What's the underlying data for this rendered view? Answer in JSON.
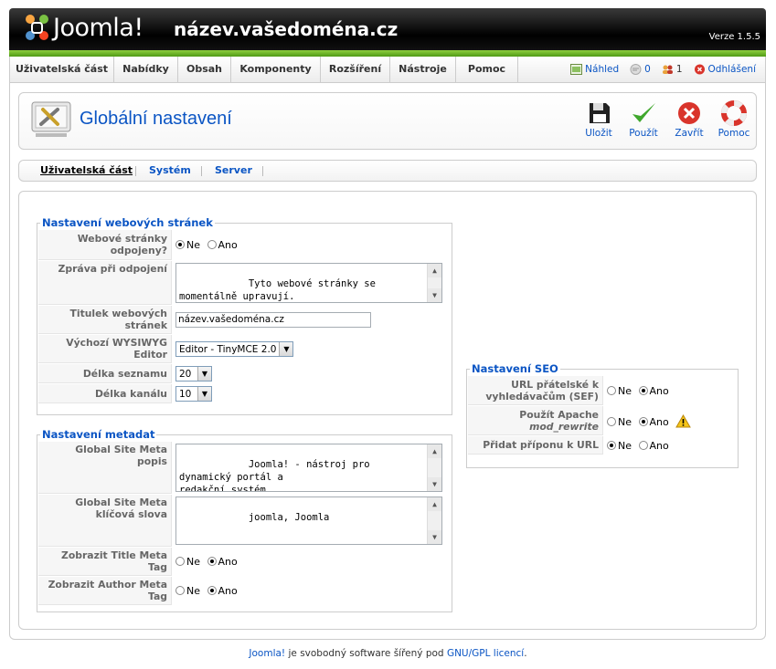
{
  "header": {
    "logo_text": "Joomla!",
    "site_name": "název.vašedoména.cz",
    "version": "Verze 1.5.5"
  },
  "menu": {
    "items": [
      "Uživatelská část",
      "Nabídky",
      "Obsah",
      "Komponenty",
      "Rozšíření",
      "Nástroje",
      "Pomoc"
    ],
    "preview": "Náhled",
    "messages_count": "0",
    "users_count": "1",
    "logout": "Odhlášení"
  },
  "toolbar": {
    "title": "Globální nastavení",
    "save": "Uložit",
    "apply": "Použít",
    "close": "Zavřít",
    "help": "Pomoc"
  },
  "submenu": {
    "items": [
      "Uživatelská část",
      "Systém",
      "Server"
    ]
  },
  "site_settings": {
    "legend": "Nastavení webových stránek",
    "offline_label": "Webové stránky odpojeny?",
    "no": "Ne",
    "yes": "Ano",
    "offline_message_label": "Zpráva při odpojení",
    "offline_message": "Tyto webové stránky se\nmomentálně upravují.\nProsíme, přijďte později.",
    "site_name_label": "Titulek webových stránek",
    "site_name_value": "název.vašedoména.cz",
    "editor_label": "Výchozí WYSIWYG Editor",
    "editor_value": "Editor - TinyMCE 2.0",
    "list_length_label": "Délka seznamu",
    "list_length_value": "20",
    "feed_length_label": "Délka kanálu",
    "feed_length_value": "10"
  },
  "metadata": {
    "legend": "Nastavení metadat",
    "desc_label": "Global Site Meta popis",
    "desc_value": "Joomla! - nástroj pro\ndynamický portál a\nredakční systém",
    "keywords_label": "Global Site Meta klíčová slova",
    "keywords_value": "joomla, Joomla",
    "show_title_label": "Zobrazit Title Meta Tag",
    "show_author_label": "Zobrazit Author Meta Tag",
    "no": "Ne",
    "yes": "Ano"
  },
  "seo": {
    "legend": "Nastavení SEO",
    "sef_label": "URL přátelské k vyhledávačům (SEF)",
    "rewrite_label_1": "Použít Apache",
    "rewrite_label_2": "mod_rewrite",
    "suffix_label": "Přidat příponu k URL",
    "no": "Ne",
    "yes": "Ano"
  },
  "footer": {
    "joomla_link": "Joomla!",
    "text": " je svobodný software šířený pod ",
    "license_link": "GNU/GPL licencí",
    "end": "."
  }
}
